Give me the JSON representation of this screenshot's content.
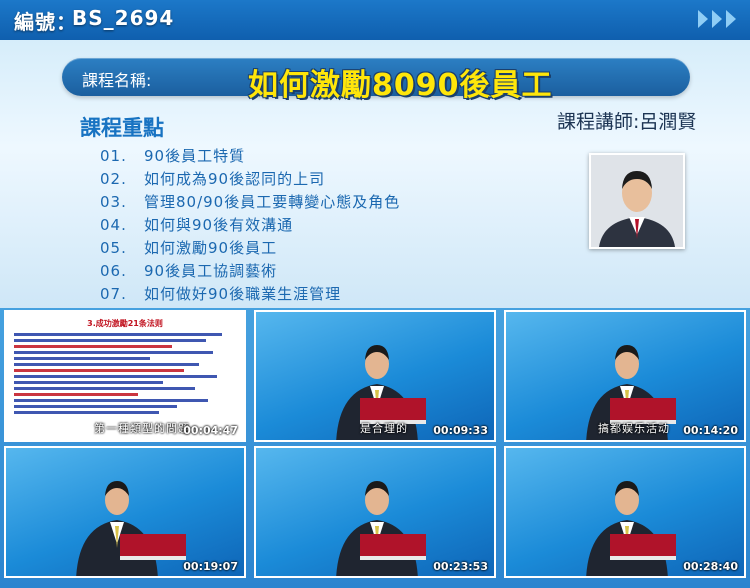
{
  "header": {
    "id_label": "編號：",
    "id_value": "BS_2694"
  },
  "course": {
    "name_label": "課程名稱:",
    "title": "如何激勵8090後員工",
    "points_heading": "課程重點",
    "instructor": "課程講師:呂潤賢",
    "points": [
      {
        "num": "01.",
        "text": "90後員工特質"
      },
      {
        "num": "02.",
        "text": "如何成為90後認同的上司"
      },
      {
        "num": "03.",
        "text": "管理80/90後員工要轉變心態及角色"
      },
      {
        "num": "04.",
        "text": "如何與90後有效溝通"
      },
      {
        "num": "05.",
        "text": "如何激勵90後員工"
      },
      {
        "num": "06.",
        "text": "90後員工協調藝術"
      },
      {
        "num": "07.",
        "text": "如何做好90後職業生涯管理"
      }
    ]
  },
  "thumbnails": [
    {
      "timecode": "00:04:47",
      "subtitle": "第一種類型的問題",
      "slide_title": "3.成功激勵21条法则"
    },
    {
      "timecode": "00:09:33",
      "subtitle": "是合理的"
    },
    {
      "timecode": "00:14:20",
      "subtitle": "搞都娱乐活动"
    },
    {
      "timecode": "00:19:07",
      "subtitle": ""
    },
    {
      "timecode": "00:23:53",
      "subtitle": ""
    },
    {
      "timecode": "00:28:40",
      "subtitle": ""
    }
  ],
  "colors": {
    "title_yellow": "#ffe60a",
    "accent_blue": "#1873c2",
    "bar_blue": "#1b5f9f"
  }
}
